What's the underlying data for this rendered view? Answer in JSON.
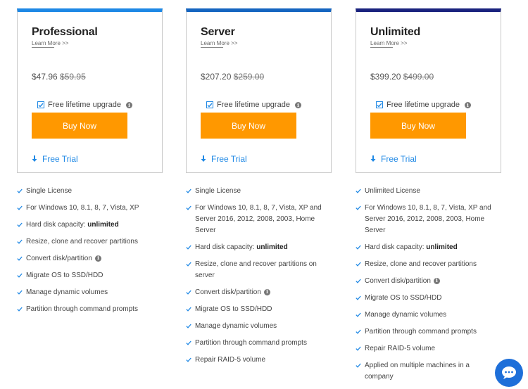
{
  "plans": [
    {
      "name": "Professional",
      "learn_more": "Learn More >>",
      "price": "$47.96",
      "old_price": "$59.95",
      "upgrade_label": "Free lifetime upgrade",
      "upgrade_checked": true,
      "buy_label": "Buy Now",
      "trial_label": "Free Trial",
      "accent": "#1e88e5",
      "features": [
        {
          "text": "Single License"
        },
        {
          "text": "For Windows 10, 8.1, 8, 7, Vista, XP"
        },
        {
          "text": "Hard disk capacity: ",
          "bold": "unlimited"
        },
        {
          "text": "Resize, clone and recover partitions"
        },
        {
          "text": "Convert disk/partition",
          "info": true
        },
        {
          "text": "Migrate OS to SSD/HDD"
        },
        {
          "text": "Manage dynamic volumes"
        },
        {
          "text": "Partition through command prompts"
        }
      ]
    },
    {
      "name": "Server",
      "learn_more": "Learn More >>",
      "price": "$207.20",
      "old_price": "$259.00",
      "upgrade_label": "Free lifetime upgrade",
      "upgrade_checked": true,
      "buy_label": "Buy Now",
      "trial_label": "Free Trial",
      "accent": "#1565c0",
      "features": [
        {
          "text": "Single License"
        },
        {
          "text": "For Windows 10, 8.1, 8, 7, Vista, XP and Server 2016, 2012, 2008, 2003, Home Server"
        },
        {
          "text": "Hard disk capacity: ",
          "bold": "unlimited"
        },
        {
          "text": "Resize, clone and recover partitions on server"
        },
        {
          "text": "Convert disk/partition",
          "info": true
        },
        {
          "text": "Migrate OS to SSD/HDD"
        },
        {
          "text": "Manage dynamic volumes"
        },
        {
          "text": "Partition through command prompts"
        },
        {
          "text": "Repair RAID-5 volume"
        }
      ]
    },
    {
      "name": "Unlimited",
      "learn_more": "Learn More >>",
      "price": "$399.20",
      "old_price": "$499.00",
      "upgrade_label": "Free lifetime upgrade",
      "upgrade_checked": true,
      "buy_label": "Buy Now",
      "trial_label": "Free Trial",
      "accent": "#1a237e",
      "features": [
        {
          "text": "Unlimited License"
        },
        {
          "text": "For Windows 10, 8.1, 8, 7, Vista, XP and Server 2016, 2012, 2008, 2003, Home Server"
        },
        {
          "text": "Hard disk capacity: ",
          "bold": "unlimited"
        },
        {
          "text": "Resize, clone and recover partitions"
        },
        {
          "text": "Convert disk/partition",
          "info": true
        },
        {
          "text": "Migrate OS to SSD/HDD"
        },
        {
          "text": "Manage dynamic volumes"
        },
        {
          "text": "Partition through command prompts"
        },
        {
          "text": "Repair RAID-5 volume"
        },
        {
          "text": "Applied on multiple machines in a company"
        }
      ]
    }
  ],
  "icons": {
    "checkbox": "checkbox-checked-icon",
    "info": "info-icon",
    "trial": "download-arrow-icon",
    "feature": "check-icon",
    "chat": "chat-bubble-icon"
  },
  "colors": {
    "buy_button": "#ff9800",
    "link": "#1e88e5",
    "check": "#1e88e5",
    "chat_button": "#1e6fd9"
  }
}
